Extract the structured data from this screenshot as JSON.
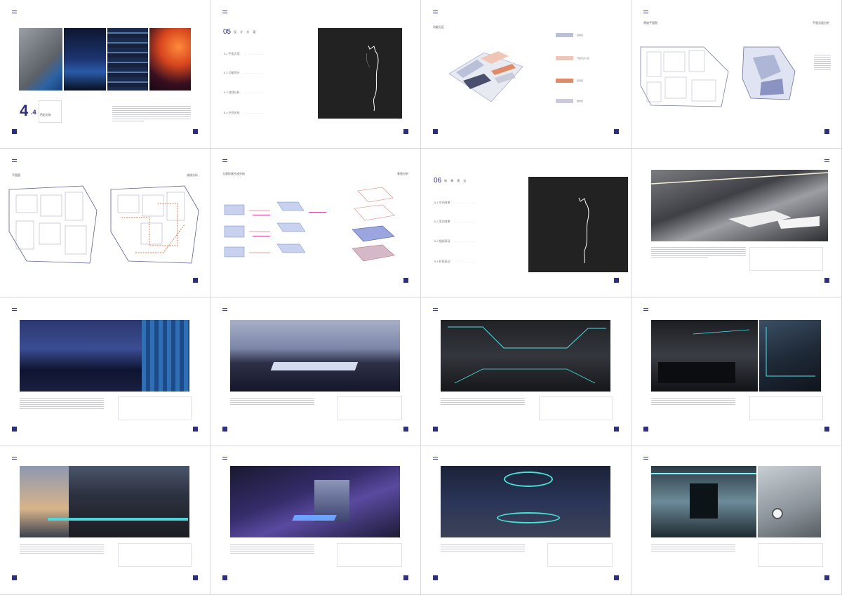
{
  "pages": {
    "p1": {
      "section_num": "4",
      "section_sub": ".4",
      "label": "色彩分析"
    },
    "p2": {
      "chapter_num": "05",
      "chapter_title": "设 计 方 案",
      "items": [
        "5.1 平面方案",
        "5.2 功能划分",
        "5.3 流线分析",
        "5.4 空间关系"
      ]
    },
    "p3": {
      "title": "功能分区",
      "legend": [
        "会客区",
        "开放式办公区",
        "接待区",
        "餐饮区"
      ]
    },
    "p4": {
      "title_left": "原始平面图",
      "title_right": "平面总面分析"
    },
    "p5": {
      "title_left": "平面图",
      "title_right": "流线分析"
    },
    "p6": {
      "title_left": "立面形体生成分析",
      "title_right": "垂直分析"
    },
    "p7": {
      "chapter_num": "06",
      "chapter_title": "效 果 表 达",
      "items": [
        "6.1 空间效果",
        "6.2 室内效果",
        "6.3 细部表现",
        "6.4 材质表达"
      ]
    },
    "p8": {
      "header": "效果图展示"
    },
    "p9": {
      "header": "效果图展示"
    },
    "p10": {
      "header": "效果图展示"
    },
    "p11": {
      "header": "效果图展示"
    },
    "p12": {
      "header": "效果图展示"
    },
    "p13": {
      "header": "效果图展示"
    },
    "p14": {
      "header": "效果图展示"
    },
    "p15": {
      "header": "效果图展示"
    },
    "p16": {
      "header": "效果图展示"
    }
  },
  "colors": {
    "accent": "#2e2f7e",
    "legend": [
      "#b9c0d8",
      "#efc6b5",
      "#df8a69",
      "#c9cbdb"
    ]
  }
}
